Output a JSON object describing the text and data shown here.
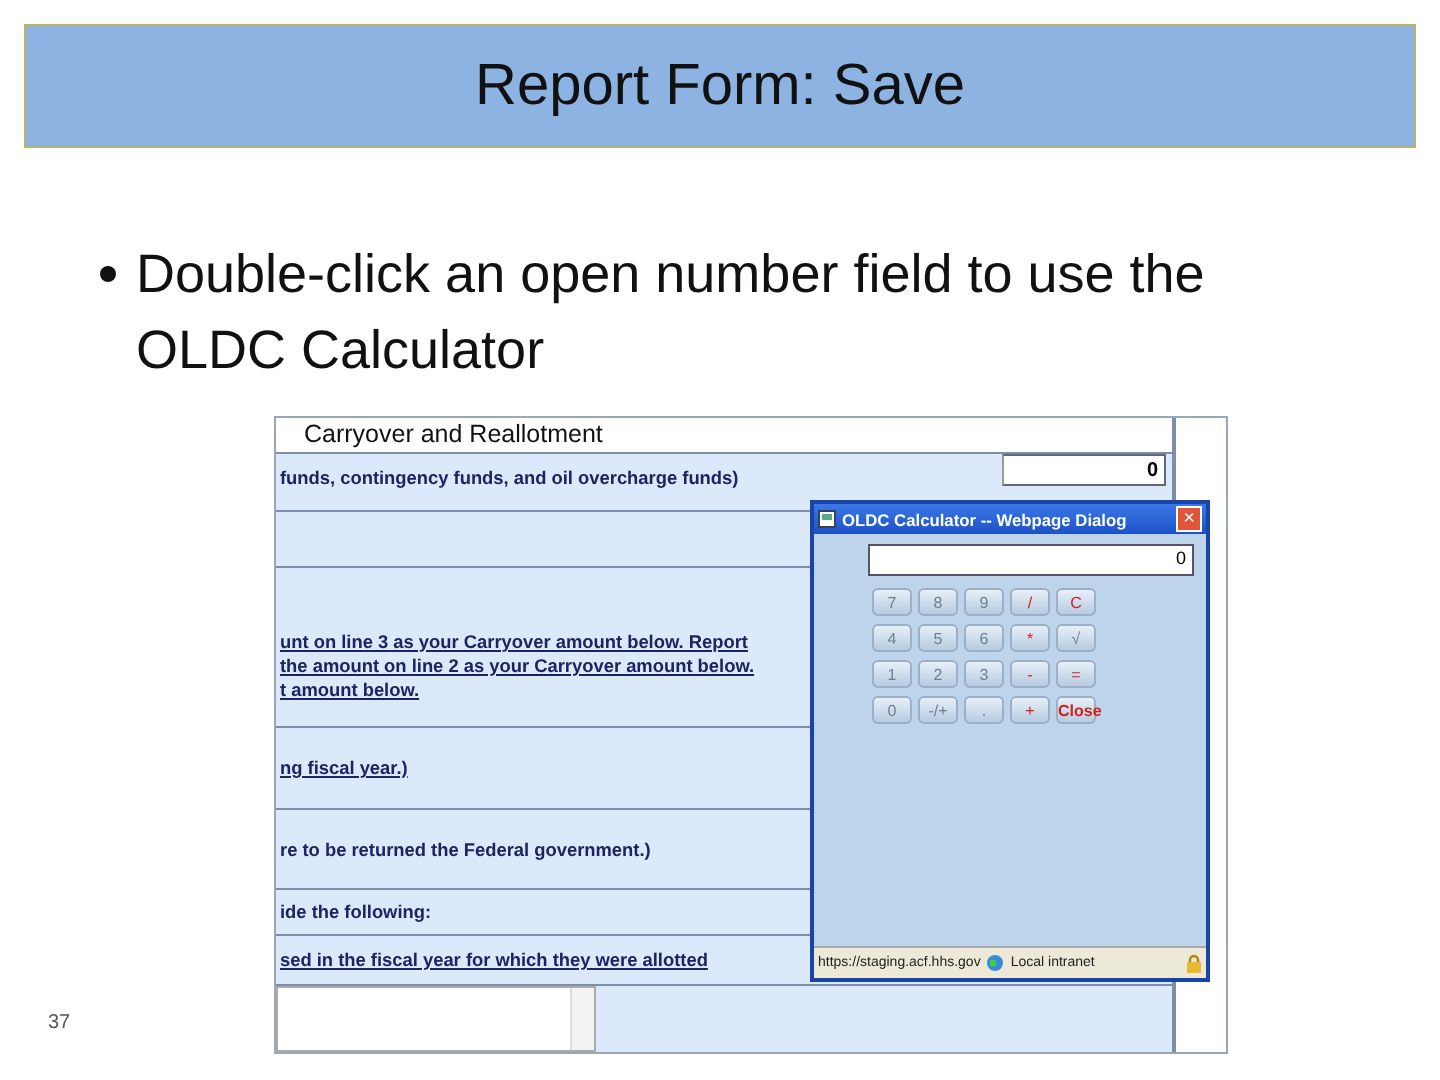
{
  "slide": {
    "title": "Report Form: Save",
    "bullet": "Double-click an open number field to use the OLDC Calculator",
    "page_number": "37"
  },
  "form": {
    "heading": "Carryover and Reallotment",
    "rows": [
      {
        "lines": [
          "funds, contingency funds, and oil overcharge funds)"
        ],
        "underline": false,
        "field": "0"
      },
      {
        "lines": []
      },
      {
        "lines": [
          "unt on line 3 as your Carryover amount below. Report",
          "the amount on line 2 as your Carryover amount below.",
          "t amount below."
        ],
        "underline": true
      },
      {
        "lines": [
          "ng fiscal year.)"
        ],
        "underline": true
      },
      {
        "lines": [
          "re to be returned the Federal government.)"
        ],
        "underline": false
      },
      {
        "lines": [
          "ide the following:"
        ],
        "underline": false
      },
      {
        "lines": [
          "sed in the fiscal year for which they were allotted"
        ],
        "underline": true
      }
    ]
  },
  "dialog": {
    "title": "OLDC Calculator -- Webpage Dialog",
    "close": "×",
    "display": "0",
    "keys": [
      {
        "label": "7",
        "kind": "digit"
      },
      {
        "label": "8",
        "kind": "digit"
      },
      {
        "label": "9",
        "kind": "digit"
      },
      {
        "label": "/",
        "kind": "op"
      },
      {
        "label": "C",
        "kind": "op"
      },
      {
        "label": "4",
        "kind": "digit"
      },
      {
        "label": "5",
        "kind": "digit"
      },
      {
        "label": "6",
        "kind": "digit"
      },
      {
        "label": "*",
        "kind": "op"
      },
      {
        "label": "√",
        "kind": "digit"
      },
      {
        "label": "1",
        "kind": "digit"
      },
      {
        "label": "2",
        "kind": "digit"
      },
      {
        "label": "3",
        "kind": "digit"
      },
      {
        "label": "-",
        "kind": "op"
      },
      {
        "label": "=",
        "kind": "op"
      },
      {
        "label": "0",
        "kind": "digit"
      },
      {
        "label": "-/+",
        "kind": "digit"
      },
      {
        "label": ".",
        "kind": "digit"
      },
      {
        "label": "+",
        "kind": "op"
      },
      {
        "label": "Close",
        "kind": "close"
      }
    ],
    "status_url": "https://staging.acf.hhs.gov",
    "status_zone": "Local intranet"
  }
}
